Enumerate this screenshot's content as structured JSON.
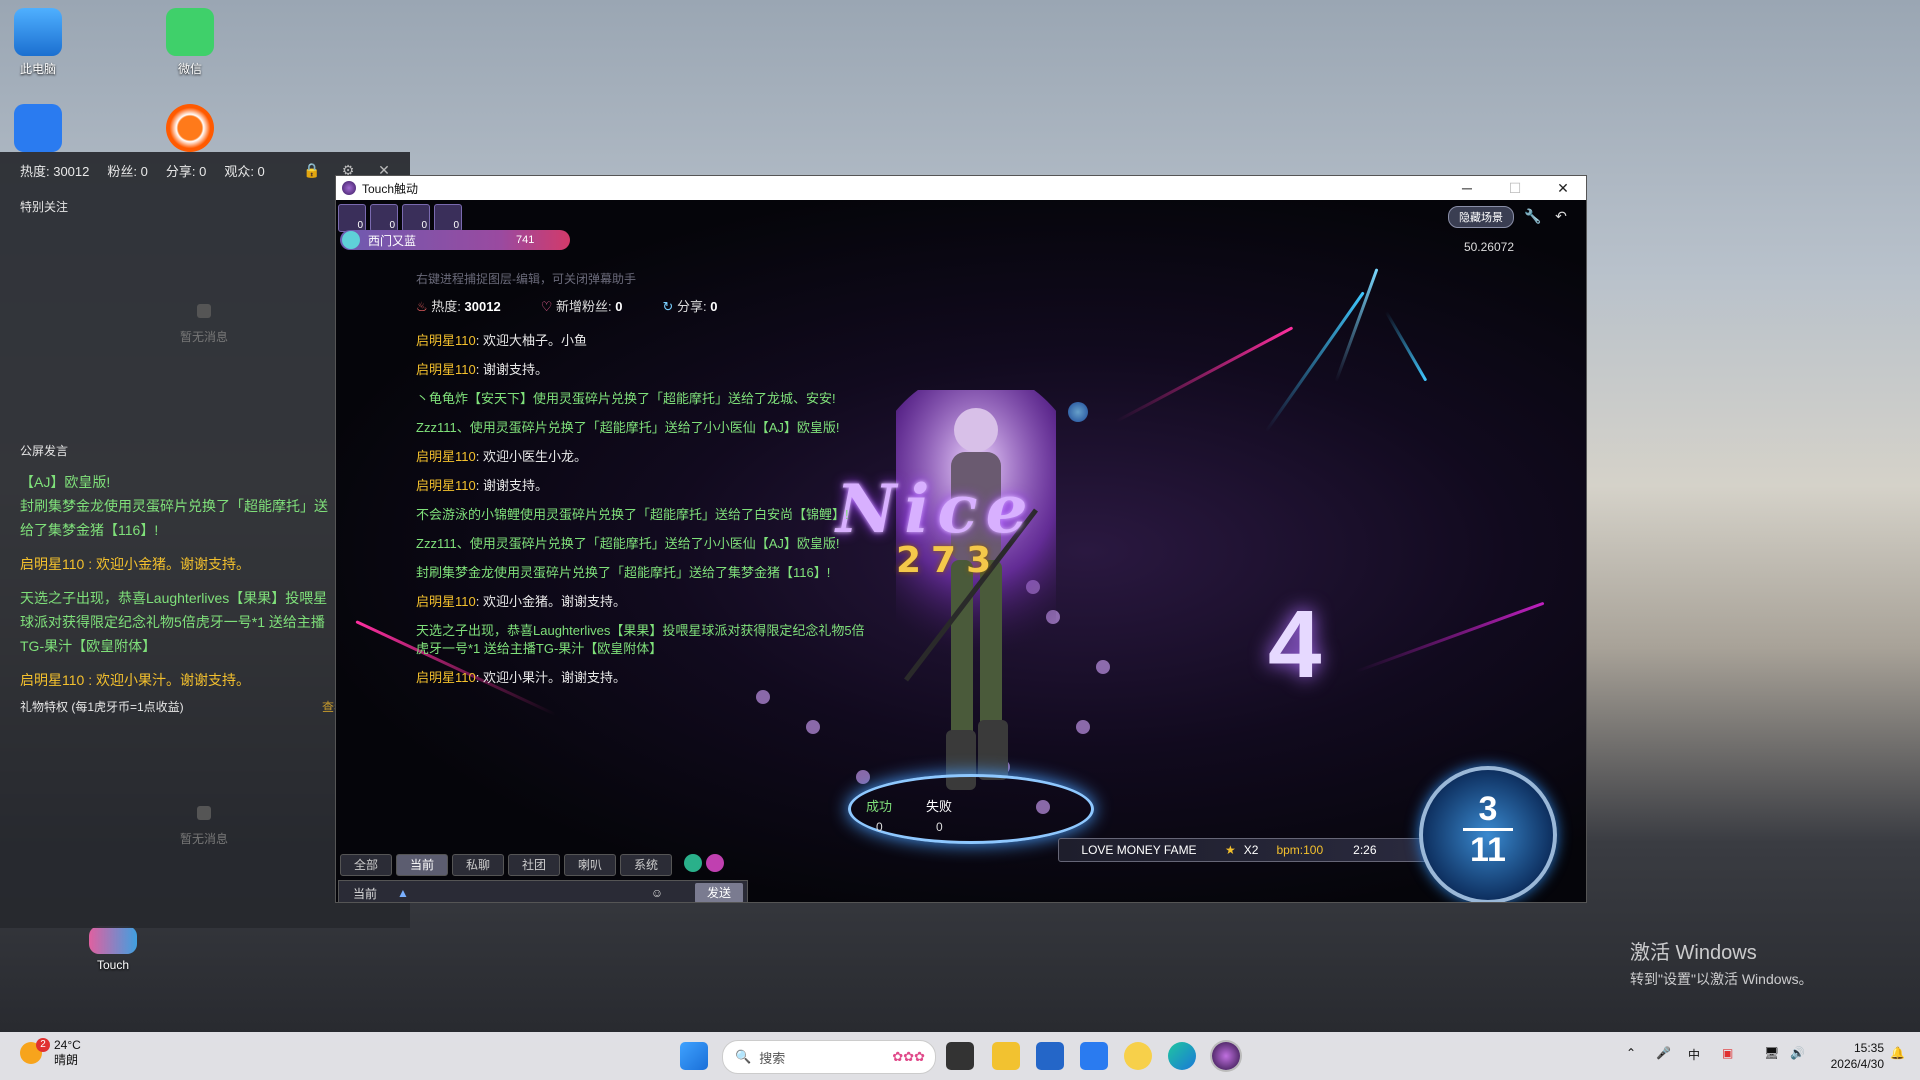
{
  "desktop": {
    "icons": [
      "此电脑",
      "微信",
      "Touch"
    ]
  },
  "stream_panel": {
    "stats": {
      "heat": "热度: 30012",
      "fans": "粉丝: 0",
      "shares": "分享: 0",
      "viewers": "观众: 0"
    },
    "special_follow": "特别关注",
    "empty_1": "暂无消息",
    "public_title": "公屏发言",
    "messages": [
      {
        "text": "【AJ】欧皇版!\n封刷集梦金龙使用灵蛋碎片兑换了「超能摩托」送给了集梦金猪【116】!",
        "color": "g"
      },
      {
        "text": "启明星110 : 欢迎小金猪。谢谢支持。",
        "color": "y"
      },
      {
        "text": "天选之子出现，恭喜Laughterlives【果果】投喂星球派对获得限定纪念礼物5倍虎牙一号*1 送给主播TG-果汁【欧皇附体】",
        "color": "g"
      },
      {
        "text": "启明星110 : 欢迎小果汁。谢谢支持。",
        "color": "y"
      }
    ],
    "gift_privilege": "礼物特权 (每1虎牙币=1点收益)",
    "gift_link": "查看",
    "empty_2": "暂无消息"
  },
  "game": {
    "window_title": "Touch触动",
    "hud_counts": [
      "0",
      "0",
      "0",
      "0"
    ],
    "player_name": "西门又蓝",
    "player_level": "741",
    "hint": "右键进程捕捉图层-编辑，可关闭弹幕助手",
    "heat_label": "热度:",
    "heat_value": "30012",
    "fans_label": "新增粉丝:",
    "fans_value": "0",
    "share_label": "分享:",
    "share_value": "0",
    "chat": [
      {
        "name": "启明星110",
        "text": ": 欢迎大柚子。小鱼",
        "color": "w"
      },
      {
        "name": "启明星110",
        "text": ": 谢谢支持。",
        "color": "w"
      },
      {
        "name": "",
        "text": "丶龟龟炸【安天下】使用灵蛋碎片兑换了「超能摩托」送给了龙城、安安!",
        "color": "g"
      },
      {
        "name": "",
        "text": "Zzz111、使用灵蛋碎片兑换了「超能摩托」送给了小小医仙【AJ】欧皇版!",
        "color": "g"
      },
      {
        "name": "启明星110",
        "text": ": 欢迎小医生小龙。",
        "color": "w"
      },
      {
        "name": "启明星110",
        "text": ": 谢谢支持。",
        "color": "w"
      },
      {
        "name": "",
        "text": "不会游泳的小锦鲤使用灵蛋碎片兑换了「超能摩托」送给了白安尚【锦鲤】!",
        "color": "g"
      },
      {
        "name": "",
        "text": "Zzz111、使用灵蛋碎片兑换了「超能摩托」送给了小小医仙【AJ】欧皇版!",
        "color": "g"
      },
      {
        "name": "",
        "text": "封刷集梦金龙使用灵蛋碎片兑换了「超能摩托」送给了集梦金猪【116】!",
        "color": "g"
      },
      {
        "name": "启明星110",
        "text": ": 欢迎小金猪。谢谢支持。",
        "color": "w"
      },
      {
        "name": "",
        "text": "天选之子出现，恭喜Laughterlives【果果】投喂星球派对获得限定纪念礼物5倍虎牙一号*1 送给主播TG-果汁【欧皇附体】",
        "color": "g"
      },
      {
        "name": "启明星110",
        "text": ": 欢迎小果汁。谢谢支持。",
        "color": "w"
      }
    ],
    "nice": "Nice",
    "combo": "273",
    "big_number": "4",
    "success_label": "成功",
    "fail_label": "失败",
    "success_count": "0",
    "fail_count": "0",
    "hide_scene": "隐藏场景",
    "score": "50.26072",
    "song": "LOVE MONEY FAME",
    "multiplier": "X2",
    "bpm": "bpm:100",
    "time": "2:26",
    "dial_top": "3",
    "dial_bottom": "11",
    "tabs": [
      "全部",
      "当前",
      "私聊",
      "社团",
      "喇叭",
      "系统"
    ],
    "active_tab": "当前",
    "input_channel": "当前",
    "send": "发送"
  },
  "taskbar": {
    "weather_temp": "24°C",
    "weather_desc": "晴朗",
    "weather_badge": "2",
    "search": "搜索",
    "time": "15:35",
    "date": "2026/4/30"
  },
  "watermark": {
    "line1": "激活 Windows",
    "line2": "转到\"设置\"以激活 Windows。"
  }
}
